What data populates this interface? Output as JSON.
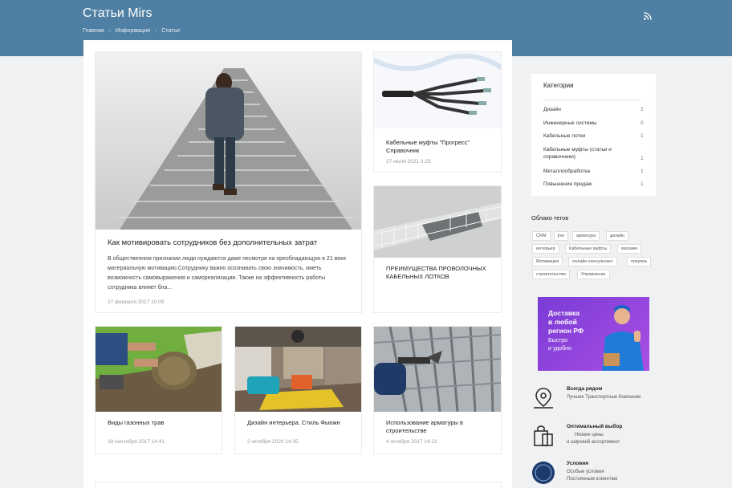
{
  "header": {
    "title": "Статьи Mirs",
    "breadcrumb": [
      "Главная",
      "Информация",
      "Статьи"
    ],
    "rss_icon": "rss-icon"
  },
  "articles": [
    {
      "title": "Как мотивировать сотрудников без дополнительных затрат",
      "excerpt": "В общественном признании люди нуждаются даже несмотря на преобладающую в 21 веке материальную мотивацию.Сотруднику важно осознавать свою значимость, иметь возможность самовыражения и самореализации. Также на эффективность работы сотрудника влияет бла...",
      "date": "27 февраля 2017 10:09"
    },
    {
      "title": "Кабельные муфты \"Прогресс\" Справочник",
      "date": "27 июля 2021 0:25"
    },
    {
      "title": "ПРЕИМУЩЕСТВА ПРОВОЛОЧНЫХ КАБЕЛЬНЫХ ЛОТКОВ",
      "date": ""
    },
    {
      "title": "Виды газонных трав",
      "date": "28 сентября 2017 14:41"
    },
    {
      "title": "Дизайн интерьера. Стиль Фьюжн",
      "date": "2 октября 2020 14:35"
    },
    {
      "title": "Использование арматуры в строительстве",
      "date": "4 октября 2017 14:23"
    }
  ],
  "sidebar": {
    "categories_title": "Категории",
    "categories": [
      {
        "name": "Дизайн",
        "count": "2"
      },
      {
        "name": "Инженерные системы",
        "count": "0"
      },
      {
        "name": "Кабельные лотки",
        "count": "1"
      },
      {
        "name": "Кабельные муфты (статьи и справочники)",
        "count": "1"
      },
      {
        "name": "Металлообработка",
        "count": "1"
      },
      {
        "name": "Повышение продаж",
        "count": "1"
      }
    ],
    "tags_title": "Облако тегов",
    "tags": [
      "CRM",
      "jivo",
      "арматура",
      "дизайн",
      "интерьер",
      "Кабельные муфты",
      "магазин",
      "Мотивация",
      "онлайн консультант",
      "покупка",
      "строительство",
      "Управление"
    ],
    "banner": {
      "line1": "Доставка",
      "line2": "в любой",
      "line3": "регион РФ",
      "line4": "Быстро",
      "line5": "и удобно"
    },
    "features": [
      {
        "icon": "map-pin-icon",
        "title": "Всегда рядом",
        "sub1": "Лучшие Транспортные Компании",
        "sub2": ""
      },
      {
        "icon": "shopping-bags-icon",
        "title": "Оптимальный выбор",
        "sub1": "Низкие цены",
        "sub2": "и широкий ассортимент"
      },
      {
        "icon": "conditions-badge-icon",
        "title": "Условия",
        "sub1": "Особые условия",
        "sub2": "Постоянным клиентам"
      }
    ]
  }
}
